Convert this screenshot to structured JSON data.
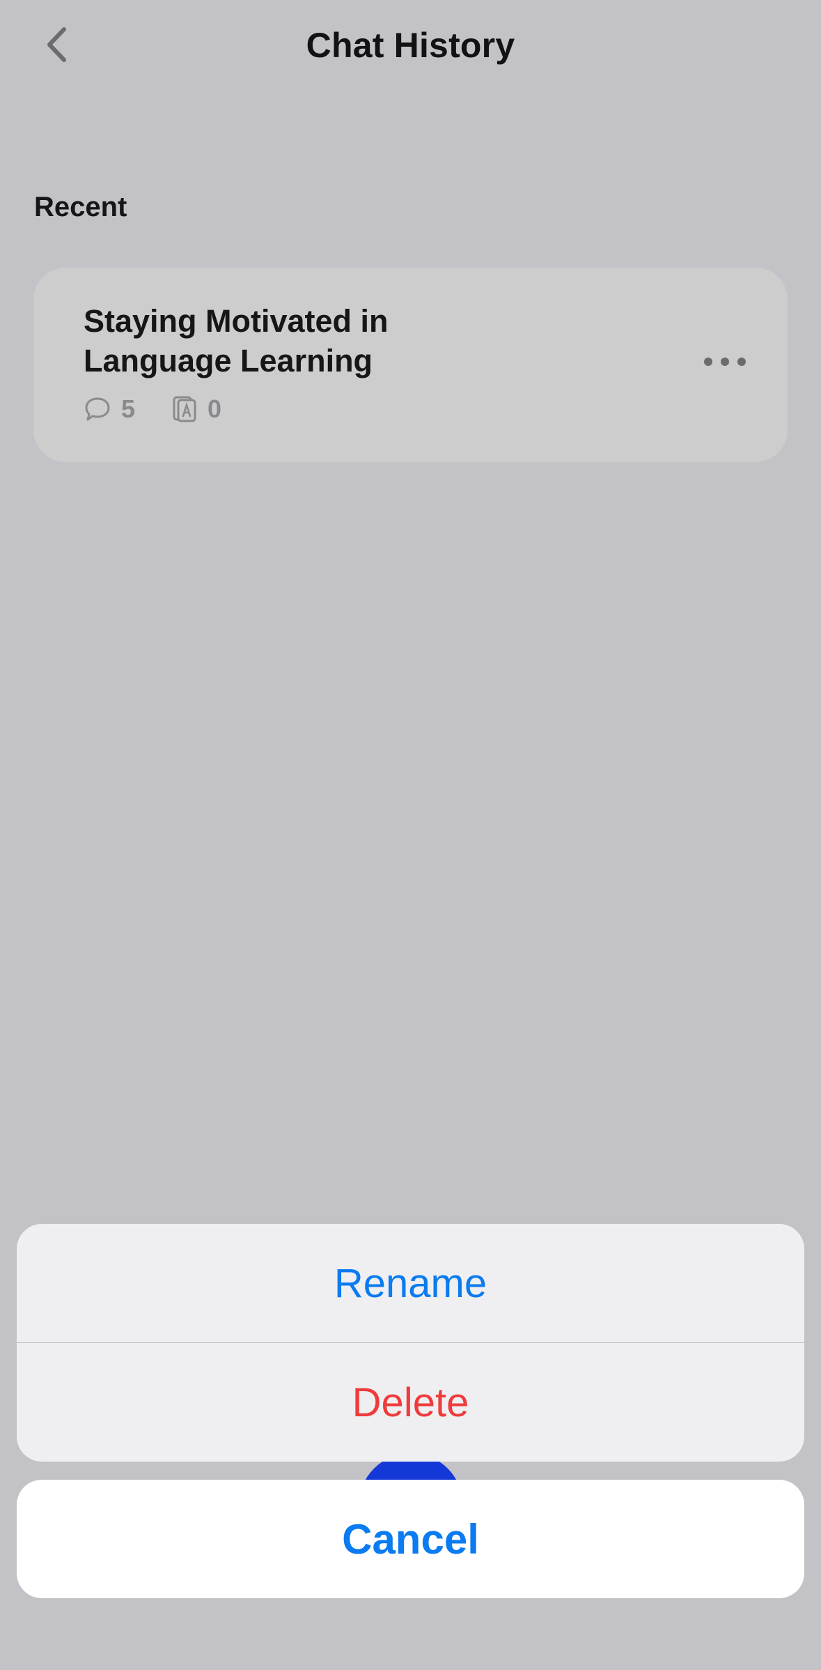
{
  "header": {
    "title": "Chat History",
    "back_icon": "chevron-left-icon"
  },
  "recent": {
    "title": "Recent",
    "items": [
      {
        "title_line1": "Staying Motivated in",
        "title_line2": "Language Learning",
        "message_count": "5",
        "vocab_count": "0",
        "message_icon": "speech-bubble-icon",
        "vocab_icon": "flashcard-a-icon",
        "more_icon": "ellipsis-icon"
      }
    ]
  },
  "action_sheet": {
    "rename_label": "Rename",
    "delete_label": "Delete",
    "cancel_label": "Cancel"
  },
  "colors": {
    "background": "#c3c3c7",
    "card": "#cdcdcd",
    "action_blue": "#0a7bf0",
    "action_red": "#ef3b3b",
    "fab_blue": "#1437d8"
  }
}
